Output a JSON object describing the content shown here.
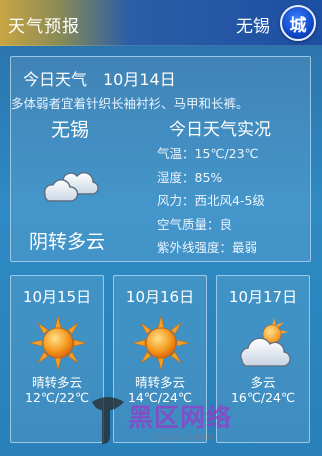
{
  "header": {
    "app_title": "天气预报",
    "city": "无锡",
    "city_button_label": "城"
  },
  "today": {
    "header": "今日天气　10月14日",
    "advice": "多体弱者宜着针织长袖衬衫、马甲和长裤。",
    "city": "无锡",
    "description": "阴转多云",
    "icon": "cloud-icon",
    "details_title": "今日天气实况",
    "details": [
      "气温：15℃/23℃",
      "湿度：85%",
      "风力：西北风4-5级",
      "空气质量：良",
      "紫外线强度：最弱"
    ]
  },
  "forecast": [
    {
      "date": "10月15日",
      "description": "晴转多云",
      "temp": "12℃/22℃",
      "icon": "sun-icon"
    },
    {
      "date": "10月16日",
      "description": "晴转多云",
      "temp": "14℃/24℃",
      "icon": "sun-icon"
    },
    {
      "date": "10月17日",
      "description": "多云",
      "temp": "16℃/24℃",
      "icon": "cloud-sun-icon"
    }
  ],
  "watermark": {
    "text": "黑区网络",
    "sub": "heiqu.com"
  },
  "colors": {
    "background": "#2f8ac4",
    "title_bar_left": "#c8a544",
    "title_bar_right": "#1c4fa2",
    "city_button": "#1047c8",
    "sun": "#f5a623"
  }
}
